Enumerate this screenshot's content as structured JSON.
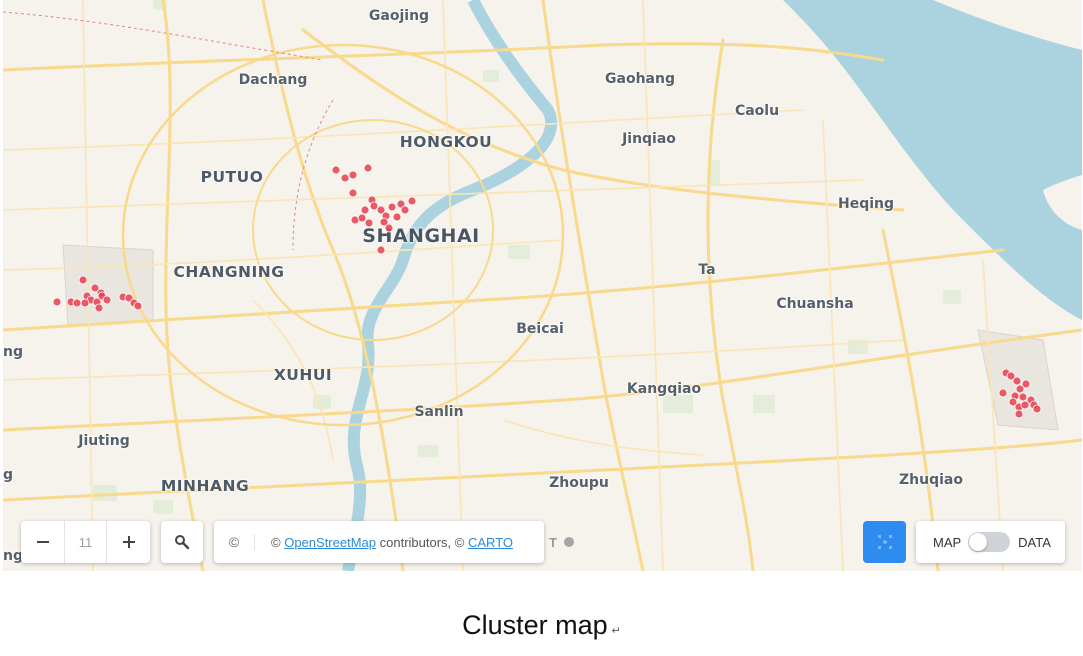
{
  "map": {
    "places": [
      {
        "name": "Gaojing",
        "kind": "town"
      },
      {
        "name": "Dachang",
        "kind": "town"
      },
      {
        "name": "Gaohang",
        "kind": "town"
      },
      {
        "name": "Caolu",
        "kind": "town"
      },
      {
        "name": "HONGKOU",
        "kind": "district"
      },
      {
        "name": "Jinqiao",
        "kind": "town"
      },
      {
        "name": "PUTUO",
        "kind": "district"
      },
      {
        "name": "Heqing",
        "kind": "town"
      },
      {
        "name": "SHANGHAI",
        "kind": "city"
      },
      {
        "name": "CHANGNING",
        "kind": "district"
      },
      {
        "name": "Ta",
        "kind": "town"
      },
      {
        "name": "Chuansha",
        "kind": "town"
      },
      {
        "name": "Beicai",
        "kind": "town"
      },
      {
        "name": "XUHUI",
        "kind": "district"
      },
      {
        "name": "Kangqiao",
        "kind": "town"
      },
      {
        "name": "Sanlin",
        "kind": "town"
      },
      {
        "name": "Jiuting",
        "kind": "town"
      },
      {
        "name": "MINHANG",
        "kind": "district"
      },
      {
        "name": "Zhoupu",
        "kind": "town"
      },
      {
        "name": "Zhuqiao",
        "kind": "town"
      },
      {
        "name": "ng",
        "kind": "town"
      },
      {
        "name": "g",
        "kind": "town"
      },
      {
        "name": "ng",
        "kind": "town"
      }
    ],
    "cluster_color": "#e8404f",
    "water_color": "#aad3df",
    "road_color": "#f9d98c"
  },
  "controls": {
    "zoom_out_icon": "minus-icon",
    "zoom_level": "11",
    "zoom_in_icon": "plus-icon",
    "search_icon": "search-icon",
    "attribution_icon": "©",
    "attribution_prefix": "©",
    "osm_link": "OpenStreetMap",
    "attribution_middle": "contributors, ©",
    "carto_link": "CARTO",
    "cluster_button_icon": "cluster-icon",
    "toggle_left": "MAP",
    "toggle_right": "DATA",
    "toggle_state": "MAP",
    "accent": "#2e8cf0"
  },
  "caption": {
    "text": "Cluster map",
    "mark": "↵"
  }
}
